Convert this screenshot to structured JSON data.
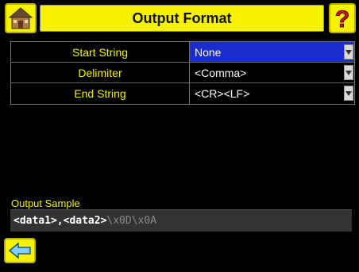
{
  "header": {
    "title": "Output Format"
  },
  "icons": {
    "home": "home-icon",
    "help": "help-question-icon",
    "back": "back-arrow-icon",
    "dropdown": "chevron-down-icon"
  },
  "settings": [
    {
      "label": "Start String",
      "value": "None",
      "selected": true
    },
    {
      "label": "Delimiter",
      "value": "<Comma>",
      "selected": false
    },
    {
      "label": "End String",
      "value": "<CR><LF>",
      "selected": false
    }
  ],
  "sample": {
    "label": "Output Sample",
    "main": "<data1>,<data2>",
    "suffix": "\\x0D\\x0A"
  },
  "colors": {
    "accent": "#f7f200",
    "selected": "#1a2ccc",
    "background": "#000000"
  }
}
